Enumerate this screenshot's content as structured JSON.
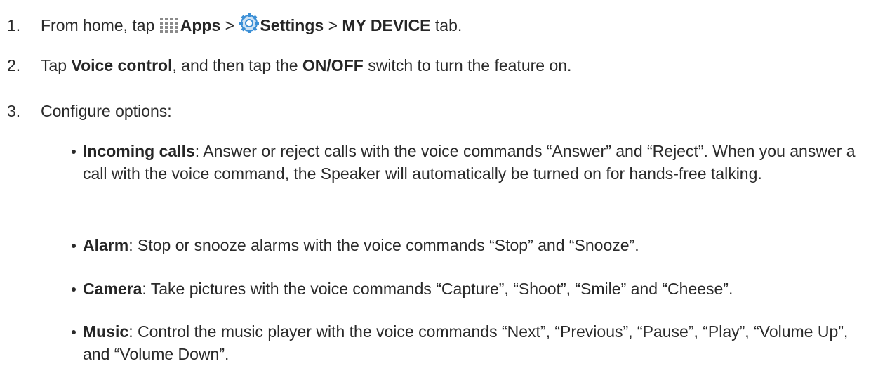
{
  "steps": [
    {
      "number": "1.",
      "prefix": "From home, tap",
      "apps_label": "Apps",
      "sep1": ">",
      "settings_label": "Settings",
      "sep2": ">",
      "tab_label": "MY DEVICE",
      "suffix": "tab."
    },
    {
      "number": "2.",
      "prefix": "Tap",
      "voice_label": "Voice control",
      "mid": ", and then tap the",
      "switch_label": "ON/OFF",
      "suffix": "switch to turn the feature on."
    },
    {
      "number": "3.",
      "text": "Configure options:"
    }
  ],
  "options": [
    {
      "term": "Incoming calls",
      "description": ": Answer or reject calls with the voice commands “Answer” and “Reject”. When you answer a call with the voice command, the Speaker will automatically be turned on for hands-free talking."
    },
    {
      "term": "Alarm",
      "description": ": Stop or snooze alarms with the voice commands “Stop” and “Snooze”."
    },
    {
      "term": "Camera",
      "description": ": Take pictures with the voice commands “Capture”, “Shoot”, “Smile” and “Cheese”."
    },
    {
      "term": "Music",
      "description": ": Control the music player with the voice commands “Next”, “Previous”, “Pause”, “Play”, “Volume Up”, and “Volume Down”."
    }
  ],
  "icons": {
    "apps": "apps-grid-icon",
    "settings": "settings-gear-icon"
  },
  "colors": {
    "text": "#2a2a2a",
    "apps_icon": "#8a8a8a",
    "settings_icon": "#3b8fd6"
  }
}
